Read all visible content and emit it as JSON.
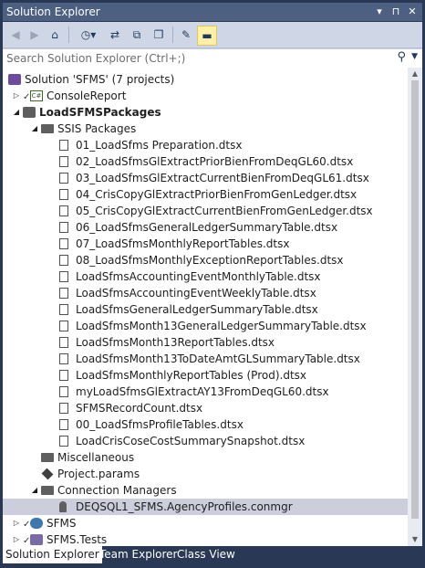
{
  "window": {
    "title": "Solution Explorer"
  },
  "titlebar_buttons": [
    "▾",
    "⊓",
    "✕"
  ],
  "search": {
    "placeholder": "Search Solution Explorer (Ctrl+;)"
  },
  "tree": [
    {
      "label": "Solution 'SFMS' (7 projects)",
      "icon": "solution-icon",
      "depth": 0,
      "expander": "",
      "bold": false
    },
    {
      "label": "ConsoleReport",
      "icon": "csharp-project-icon",
      "depth": 1,
      "expander": "collapsed",
      "bold": false
    },
    {
      "label": "LoadSFMSPackages",
      "icon": "ssis-project-icon",
      "depth": 1,
      "expander": "expanded",
      "bold": true
    },
    {
      "label": "SSIS Packages",
      "icon": "folder-icon",
      "depth": 2,
      "expander": "expanded",
      "bold": false
    },
    {
      "label": "01_LoadSfms Preparation.dtsx",
      "icon": "package-file-icon",
      "depth": 3,
      "expander": "",
      "bold": false
    },
    {
      "label": "02_LoadSfmsGlExtractPriorBienFromDeqGL60.dtsx",
      "icon": "package-file-icon",
      "depth": 3,
      "expander": "",
      "bold": false
    },
    {
      "label": "03_LoadSfmsGlExtractCurrentBienFromDeqGL61.dtsx",
      "icon": "package-file-icon",
      "depth": 3,
      "expander": "",
      "bold": false
    },
    {
      "label": "04_CrisCopyGlExtractPriorBienFromGenLedger.dtsx",
      "icon": "package-file-icon",
      "depth": 3,
      "expander": "",
      "bold": false
    },
    {
      "label": "05_CrisCopyGlExtractCurrentBienFromGenLedger.dtsx",
      "icon": "package-file-icon",
      "depth": 3,
      "expander": "",
      "bold": false
    },
    {
      "label": "06_LoadSfmsGeneralLedgerSummaryTable.dtsx",
      "icon": "package-file-icon",
      "depth": 3,
      "expander": "",
      "bold": false
    },
    {
      "label": "07_LoadSfmsMonthlyReportTables.dtsx",
      "icon": "package-file-icon",
      "depth": 3,
      "expander": "",
      "bold": false
    },
    {
      "label": "08_LoadSfmsMonthlyExceptionReportTables.dtsx",
      "icon": "package-file-icon",
      "depth": 3,
      "expander": "",
      "bold": false
    },
    {
      "label": "LoadSfmsAccountingEventMonthlyTable.dtsx",
      "icon": "package-file-icon",
      "depth": 3,
      "expander": "",
      "bold": false
    },
    {
      "label": "LoadSfmsAccountingEventWeeklyTable.dtsx",
      "icon": "package-file-icon",
      "depth": 3,
      "expander": "",
      "bold": false
    },
    {
      "label": "LoadSfmsGeneralLedgerSummaryTable.dtsx",
      "icon": "package-file-icon",
      "depth": 3,
      "expander": "",
      "bold": false
    },
    {
      "label": "LoadSfmsMonth13GeneralLedgerSummaryTable.dtsx",
      "icon": "package-file-icon",
      "depth": 3,
      "expander": "",
      "bold": false
    },
    {
      "label": "LoadSfmsMonth13ReportTables.dtsx",
      "icon": "package-file-icon",
      "depth": 3,
      "expander": "",
      "bold": false
    },
    {
      "label": "LoadSfmsMonth13ToDateAmtGLSummaryTable.dtsx",
      "icon": "package-file-icon",
      "depth": 3,
      "expander": "",
      "bold": false
    },
    {
      "label": "LoadSfmsMonthlyReportTables (Prod).dtsx",
      "icon": "package-file-icon",
      "depth": 3,
      "expander": "",
      "bold": false
    },
    {
      "label": "myLoadSfmsGlExtractAY13FromDeqGL60.dtsx",
      "icon": "package-file-icon",
      "depth": 3,
      "expander": "",
      "bold": false
    },
    {
      "label": "SFMSRecordCount.dtsx",
      "icon": "package-file-icon",
      "depth": 3,
      "expander": "",
      "bold": false
    },
    {
      "label": "00_LoadSfmsProfileTables.dtsx",
      "icon": "package-file-icon",
      "depth": 3,
      "expander": "",
      "bold": false
    },
    {
      "label": "LoadCrisCoseCostSummarySnapshot.dtsx",
      "icon": "package-file-icon",
      "depth": 3,
      "expander": "",
      "bold": false
    },
    {
      "label": "Miscellaneous",
      "icon": "folder-icon",
      "depth": 2,
      "expander": "",
      "bold": false
    },
    {
      "label": "Project.params",
      "icon": "params-icon",
      "depth": 2,
      "expander": "",
      "bold": false
    },
    {
      "label": "Connection Managers",
      "icon": "folder-icon",
      "depth": 2,
      "expander": "expanded",
      "bold": false
    },
    {
      "label": "DEQSQL1_SFMS.AgencyProfiles.conmgr",
      "icon": "connection-icon",
      "depth": 3,
      "expander": "",
      "bold": false,
      "selected": true
    },
    {
      "label": "SFMS",
      "icon": "web-project-icon",
      "depth": 1,
      "expander": "collapsed",
      "bold": false
    },
    {
      "label": "SFMS.Tests",
      "icon": "test-project-icon",
      "depth": 1,
      "expander": "collapsed",
      "bold": false
    }
  ],
  "tabs": [
    {
      "label": "Solution Explorer",
      "active": true
    },
    {
      "label": "Team Explorer",
      "active": false
    },
    {
      "label": "Class View",
      "active": false
    }
  ]
}
